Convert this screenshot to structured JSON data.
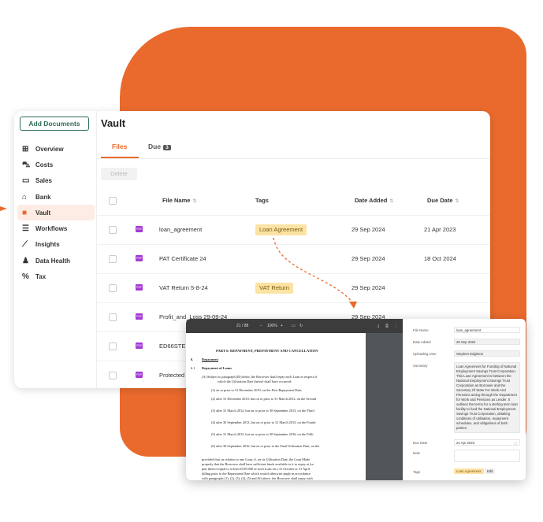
{
  "sidebar": {
    "add_button": "Add Documents",
    "items": [
      {
        "label": "Overview",
        "icon": "grid-icon"
      },
      {
        "label": "Costs",
        "icon": "cart-icon"
      },
      {
        "label": "Sales",
        "icon": "card-icon"
      },
      {
        "label": "Bank",
        "icon": "bank-icon"
      },
      {
        "label": "Vault",
        "icon": "vault-icon",
        "active": true
      },
      {
        "label": "Workflows",
        "icon": "checklist-icon"
      },
      {
        "label": "Insights",
        "icon": "chart-icon"
      },
      {
        "label": "Data Health",
        "icon": "person-icon"
      },
      {
        "label": "Tax",
        "icon": "percent-icon"
      }
    ]
  },
  "main": {
    "title": "Vault",
    "tabs": {
      "files": "Files",
      "due": "Due",
      "due_count": "3"
    },
    "delete_button": "Delete",
    "columns": {
      "file_name": "File Name",
      "tags": "Tags",
      "date_added": "Date Added",
      "due_date": "Due Date"
    },
    "rows": [
      {
        "name": "loan_agreement",
        "tag": "Loan Agreement",
        "date_added": "29 Sep 2024",
        "due_date": "21 Apr 2023"
      },
      {
        "name": "PAT Certificate 24",
        "tag": "",
        "date_added": "29 Sep 2024",
        "due_date": "18 Oct 2024"
      },
      {
        "name": "VAT Return 5-8-24",
        "tag": "VAT Return",
        "date_added": "29 Sep 2024",
        "due_date": ""
      },
      {
        "name": "Profit_and_Loss 29-09-24",
        "tag": "",
        "date_added": "29 Sep 2024",
        "due_date": ""
      },
      {
        "name": "ED66STE I",
        "tag": "",
        "date_added": "",
        "due_date": ""
      },
      {
        "name": "Protected I",
        "tag": "",
        "date_added": "",
        "due_date": ""
      }
    ]
  },
  "viewer": {
    "page_indicator": "21 / 88",
    "zoom": "100%",
    "doc": {
      "heading": "PART 6: REPAYMENT, PREPAYMENT AND CANCELLATION",
      "section_num": "6.",
      "section_title": "Repayment",
      "sub_num": "6.1",
      "sub_title": "Repayment of Loans",
      "para_a": "(A)   Subject to paragraph (B) below, the Borrower shall repay each Loan in respect of",
      "para_a2": "which the Utilisation Date thereof shall have occurred:",
      "items": [
        "(1)    on or prior to 31 December 2010, on the First Repayment Date;",
        "(2)    after 31 December 2010, but on or prior to 31 March 2012, on the Second",
        "(3)    after 31 March 2012, but on or prior to 30 September 2013, on the Third",
        "(4)    after 30 September 2013, but on or prior to 31 March 2015, on the Fourth",
        "(5)    after 31 March 2015, but on or prior to 30 September 2016, on the Fifth",
        "(6)    after 30 September 2016, but on or prior to the Final Utilisation Date, on the"
      ],
      "footer1": "provided that, in relation to any Loan, if, on its Utilisation Date, the Loan Made",
      "footer2": "properly that the Borrower shall have sufficient funds available to it to repay at (or",
      "footer3": "part thereof equal to at least £539,000 of such Loan on a 31 October or 31 April",
      "footer4": "falling prior to the Repayment Date which would otherwise apply in accordance",
      "footer5": "with paragraphs (1), (2), (3), (4), (5) and (6) above, the Borrower shall repay such"
    },
    "panel": {
      "file_name_label": "File Name",
      "file_name": "loan_agreement",
      "date_added_label": "Date Added",
      "date_added": "29 Sep 2024",
      "uploaded_label": "Uploading User",
      "uploaded": "Stephen Edginton",
      "summary_label": "Summary",
      "summary": "Loan Agreement for Funding of National Employment Savings Trust Corporation. This Loan Agreement is between the National Employment Savings Trust Corporation as Borrower and the Secretary Of State For Work And Pensions acting through the Department for Work and Pensions as Lender. It outlines the terms for a sterling term loan facility to fund the National Employment Savings Trust Corporation, detailing conditions of utilisation, repayment schedules, and obligations of both parties.",
      "due_label": "Due Date",
      "due": "21 Apr 2023",
      "note_label": "Note",
      "tags_label": "Tags",
      "tag": "Loan Agreement",
      "edit": "Edit"
    }
  },
  "colors": {
    "accent": "#ea6a2d",
    "brand_green": "#2f6b5a",
    "tag_bg": "#fce3a3",
    "pdf_badge": "#a63ad6"
  }
}
